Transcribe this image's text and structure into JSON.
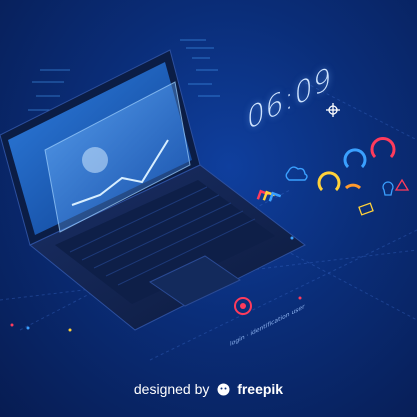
{
  "clock": {
    "time": "06:09"
  },
  "labels": {
    "login": "login · identification user"
  },
  "footer": {
    "designed_by": "designed by",
    "brand": "freepik",
    "logo_icon": "freepik-logo-icon"
  },
  "colors": {
    "background": "#0a2d78",
    "accent_red": "#ff3b5c",
    "accent_orange": "#ff9a2e",
    "accent_yellow": "#ffd13a",
    "accent_blue": "#3aa0ff",
    "screen_glow": "#3fa2ff"
  },
  "icons": [
    "cloud-icon",
    "gear-icon",
    "lock-icon",
    "mail-icon",
    "lightbulb-icon",
    "power-icon",
    "arrows-icon",
    "chart-pie-icon"
  ]
}
